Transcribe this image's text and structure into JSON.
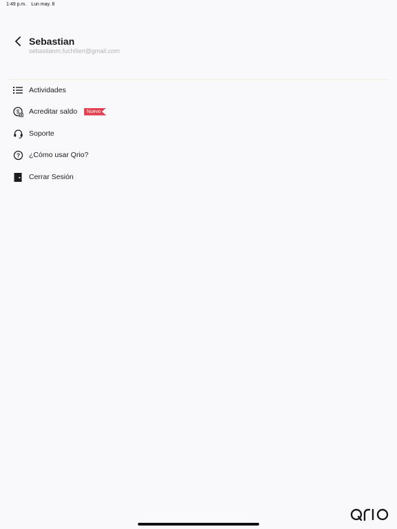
{
  "status_bar": {
    "time": "1:49 p.m.",
    "date": "Lun may. 8"
  },
  "header": {
    "back_icon": "chevron-left-icon",
    "name": "Sebastian",
    "email": "sebastianm.fuchilieri@gmail.com"
  },
  "menu": {
    "items": [
      {
        "label": "Actividades",
        "icon": "list-icon"
      },
      {
        "label": "Acreditar saldo",
        "icon": "dollar-plus-icon",
        "badge": "Nuevo"
      },
      {
        "label": "Soporte",
        "icon": "headset-icon"
      },
      {
        "label": "¿Cómo usar Qrio?",
        "icon": "help-circle-icon"
      },
      {
        "label": "Cerrar Sesión",
        "icon": "logout-door-icon"
      }
    ]
  },
  "brand": {
    "logo_icon": "qrio-logo-icon"
  },
  "colors": {
    "background": "#f9f8fb",
    "badge": "#e04050",
    "text": "#1c1c1e",
    "muted": "#b3b3b8"
  }
}
